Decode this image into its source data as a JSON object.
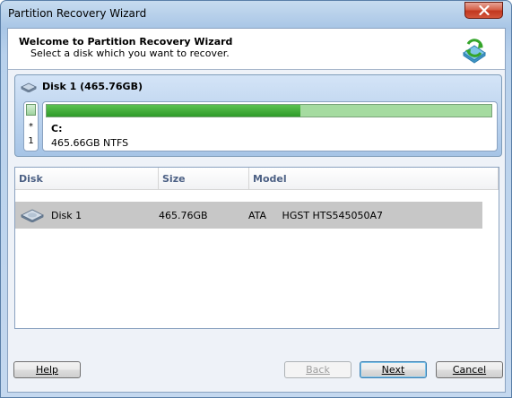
{
  "window": {
    "title": "Partition Recovery Wizard"
  },
  "header": {
    "title": "Welcome to Partition Recovery Wizard",
    "subtitle": "Select a disk which you want to recover."
  },
  "disk_map": {
    "title": "Disk 1 (465.76GB)",
    "unallocated": {
      "star": "*",
      "number": "1"
    },
    "partition": {
      "name": "C:",
      "info": "465.66GB NTFS",
      "used_fraction": 0.57
    }
  },
  "disk_list": {
    "columns": [
      "Disk",
      "Size",
      "Model"
    ],
    "rows": [
      {
        "disk": "Disk 1",
        "size": "465.76GB",
        "model": "ATA     HGST HTS545050A7"
      }
    ]
  },
  "buttons": {
    "help": "Help",
    "back": "Back",
    "next": "Next",
    "cancel": "Cancel"
  },
  "colors": {
    "accent_green": "#2e9a2a",
    "selected_row": "#c7c7c7",
    "column_header_text": "#4d6185"
  }
}
